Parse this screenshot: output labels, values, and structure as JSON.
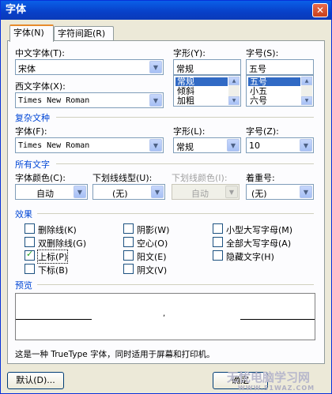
{
  "window": {
    "title": "字体",
    "close": "✕"
  },
  "tabs": [
    {
      "label": "字体(N)"
    },
    {
      "label": "字符间距(R)"
    }
  ],
  "chinese_font": {
    "label": "中文字体(T):",
    "value": "宋体"
  },
  "style": {
    "label": "字形(Y):",
    "value": "常规",
    "options": [
      "常规",
      "倾斜",
      "加粗"
    ]
  },
  "size": {
    "label": "字号(S):",
    "value": "五号",
    "options": [
      "五号",
      "小五",
      "六号"
    ]
  },
  "western_font": {
    "label": "西文字体(X):",
    "value": "Times New Roman"
  },
  "complex": {
    "group": "复杂文种",
    "font_label": "字体(F):",
    "font_value": "Times New Roman",
    "style_label": "字形(L):",
    "style_value": "常规",
    "size_label": "字号(Z):",
    "size_value": "10"
  },
  "all_text": {
    "group": "所有文字",
    "color_label": "字体颜色(C):",
    "color_value": "自动",
    "underline_label": "下划线线型(U):",
    "underline_value": "(无)",
    "ucolor_label": "下划线颜色(I):",
    "ucolor_value": "自动",
    "emphasis_label": "着重号:",
    "emphasis_value": "(无)"
  },
  "effects": {
    "group": "效果",
    "items": [
      {
        "label": "删除线(K)",
        "checked": false
      },
      {
        "label": "双删除线(G)",
        "checked": false
      },
      {
        "label": "上标(P)",
        "checked": true
      },
      {
        "label": "下标(B)",
        "checked": false
      },
      {
        "label": "阴影(W)",
        "checked": false
      },
      {
        "label": "空心(O)",
        "checked": false
      },
      {
        "label": "阳文(E)",
        "checked": false
      },
      {
        "label": "阴文(V)",
        "checked": false
      },
      {
        "label": "小型大写字母(M)",
        "checked": false
      },
      {
        "label": "全部大写字母(A)",
        "checked": false
      },
      {
        "label": "隐藏文字(H)",
        "checked": false
      }
    ]
  },
  "preview": {
    "group": "预览",
    "mark": ","
  },
  "description": "这是一种 TrueType 字体，同时适用于屏幕和打印机。",
  "buttons": {
    "default": "默认(D)...",
    "ok": "确定"
  },
  "watermark": {
    "line1": "无忧电脑学习网",
    "line2": "WWW.51WAZ.COM"
  },
  "colors": {
    "title_bar": "#0a5fe8",
    "group_text": "#0046d5",
    "selection": "#316ac5"
  }
}
